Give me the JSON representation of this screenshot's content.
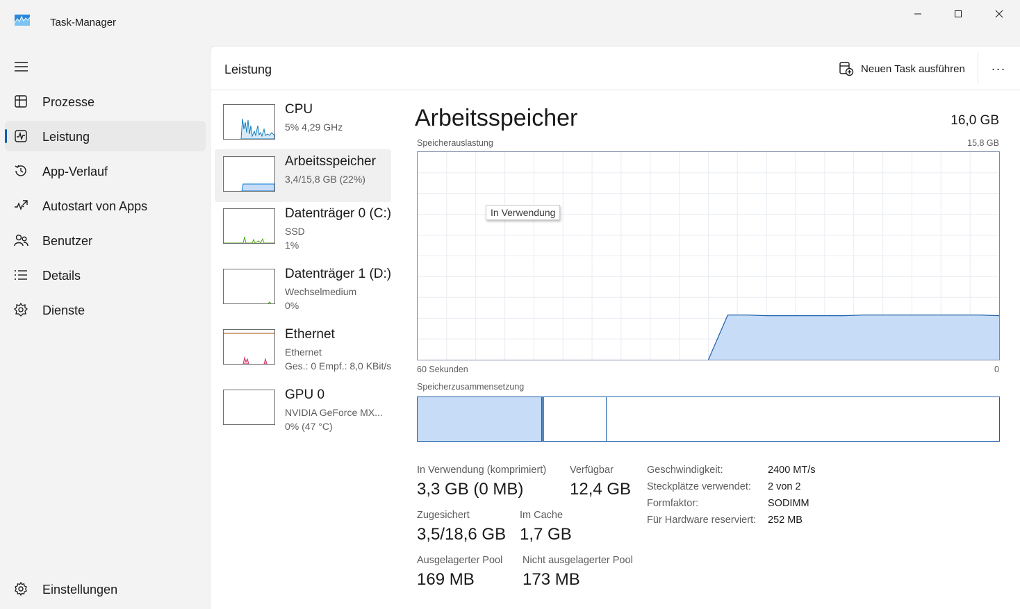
{
  "window": {
    "title": "Task-Manager",
    "icons": {
      "app": "task-manager-icon",
      "minimize": "minimize-icon",
      "maximize": "maximize-icon",
      "close": "close-icon"
    }
  },
  "sidebar": {
    "menu_icon": "hamburger-icon",
    "items": [
      {
        "label": "Prozesse",
        "icon": "processes-icon",
        "active": false
      },
      {
        "label": "Leistung",
        "icon": "performance-icon",
        "active": true
      },
      {
        "label": "App-Verlauf",
        "icon": "history-icon",
        "active": false
      },
      {
        "label": "Autostart von Apps",
        "icon": "startup-icon",
        "active": false
      },
      {
        "label": "Benutzer",
        "icon": "users-icon",
        "active": false
      },
      {
        "label": "Details",
        "icon": "details-icon",
        "active": false
      },
      {
        "label": "Dienste",
        "icon": "services-icon",
        "active": false
      }
    ],
    "settings": {
      "label": "Einstellungen",
      "icon": "gear-icon"
    }
  },
  "header": {
    "title": "Leistung",
    "run_task_label": "Neuen Task ausführen",
    "run_task_icon": "new-task-icon",
    "more_label": "···"
  },
  "resources": [
    {
      "name": "CPU",
      "sub1": "5%  4,29 GHz",
      "sub2": "",
      "color": "#117dbb"
    },
    {
      "name": "Arbeitsspeicher",
      "sub1": "3,4/15,8 GB (22%)",
      "sub2": "",
      "color": "#0078d4"
    },
    {
      "name": "Datenträger 0 (C:)",
      "sub1": "SSD",
      "sub2": "1%",
      "color": "#4da60c"
    },
    {
      "name": "Datenträger 1 (D:)",
      "sub1": "Wechselmedium",
      "sub2": "0%",
      "color": "#4da60c"
    },
    {
      "name": "Ethernet",
      "sub1": "Ethernet",
      "sub2": "Ges.: 0  Empf.: 8,0 KBit/s",
      "color": "#a74f01"
    },
    {
      "name": "GPU 0",
      "sub1": "NVIDIA GeForce MX...",
      "sub2": "0%  (47 °C)",
      "color": "#ac39ff"
    }
  ],
  "detail": {
    "title": "Arbeitsspeicher",
    "total": "16,0 GB",
    "usage_label": "Speicherauslastung",
    "usage_max": "15,8 GB",
    "time_left": "60 Sekunden",
    "time_right": "0",
    "tooltip": "In Verwendung",
    "composition_label": "Speicherzusammensetzung",
    "composition": {
      "in_use_fraction": 0.215,
      "modified_fraction": 0.003,
      "standby_fraction": 0.107
    },
    "accent": "#1b5fa8",
    "fill": "#c7dcf7"
  },
  "chart_data": {
    "type": "area",
    "title": "Speicherauslastung",
    "xlabel": "",
    "ylabel": "",
    "x": [
      60,
      58,
      56,
      54,
      52,
      50,
      48,
      46,
      44,
      42,
      40,
      38,
      36,
      34,
      32,
      30,
      28,
      26,
      24,
      22,
      20,
      18,
      16,
      14,
      12,
      10,
      8,
      6,
      4,
      2,
      0
    ],
    "y": [
      null,
      null,
      null,
      null,
      null,
      null,
      null,
      null,
      null,
      null,
      null,
      null,
      null,
      null,
      null,
      0,
      3.4,
      3.4,
      3.35,
      3.35,
      3.35,
      3.35,
      3.35,
      3.4,
      3.4,
      3.4,
      3.4,
      3.4,
      3.4,
      3.4,
      3.35
    ],
    "xlim": [
      60,
      0
    ],
    "ylim": [
      0,
      15.8
    ],
    "grid": true
  },
  "stats": {
    "in_use_label": "In Verwendung (komprimiert)",
    "in_use_value": "3,3 GB (0 MB)",
    "available_label": "Verfügbar",
    "available_value": "12,4 GB",
    "committed_label": "Zugesichert",
    "committed_value": "3,5/18,6 GB",
    "cached_label": "Im Cache",
    "cached_value": "1,7 GB",
    "paged_label": "Ausgelagerter Pool",
    "paged_value": "169 MB",
    "nonpaged_label": "Nicht ausgelagerter Pool",
    "nonpaged_value": "173 MB"
  },
  "specs": [
    {
      "label": "Geschwindigkeit:",
      "value": "2400 MT/s"
    },
    {
      "label": "Steckplätze verwendet:",
      "value": "2 von 2"
    },
    {
      "label": "Formfaktor:",
      "value": "SODIMM"
    },
    {
      "label": "Für Hardware reserviert:",
      "value": "252 MB"
    }
  ]
}
